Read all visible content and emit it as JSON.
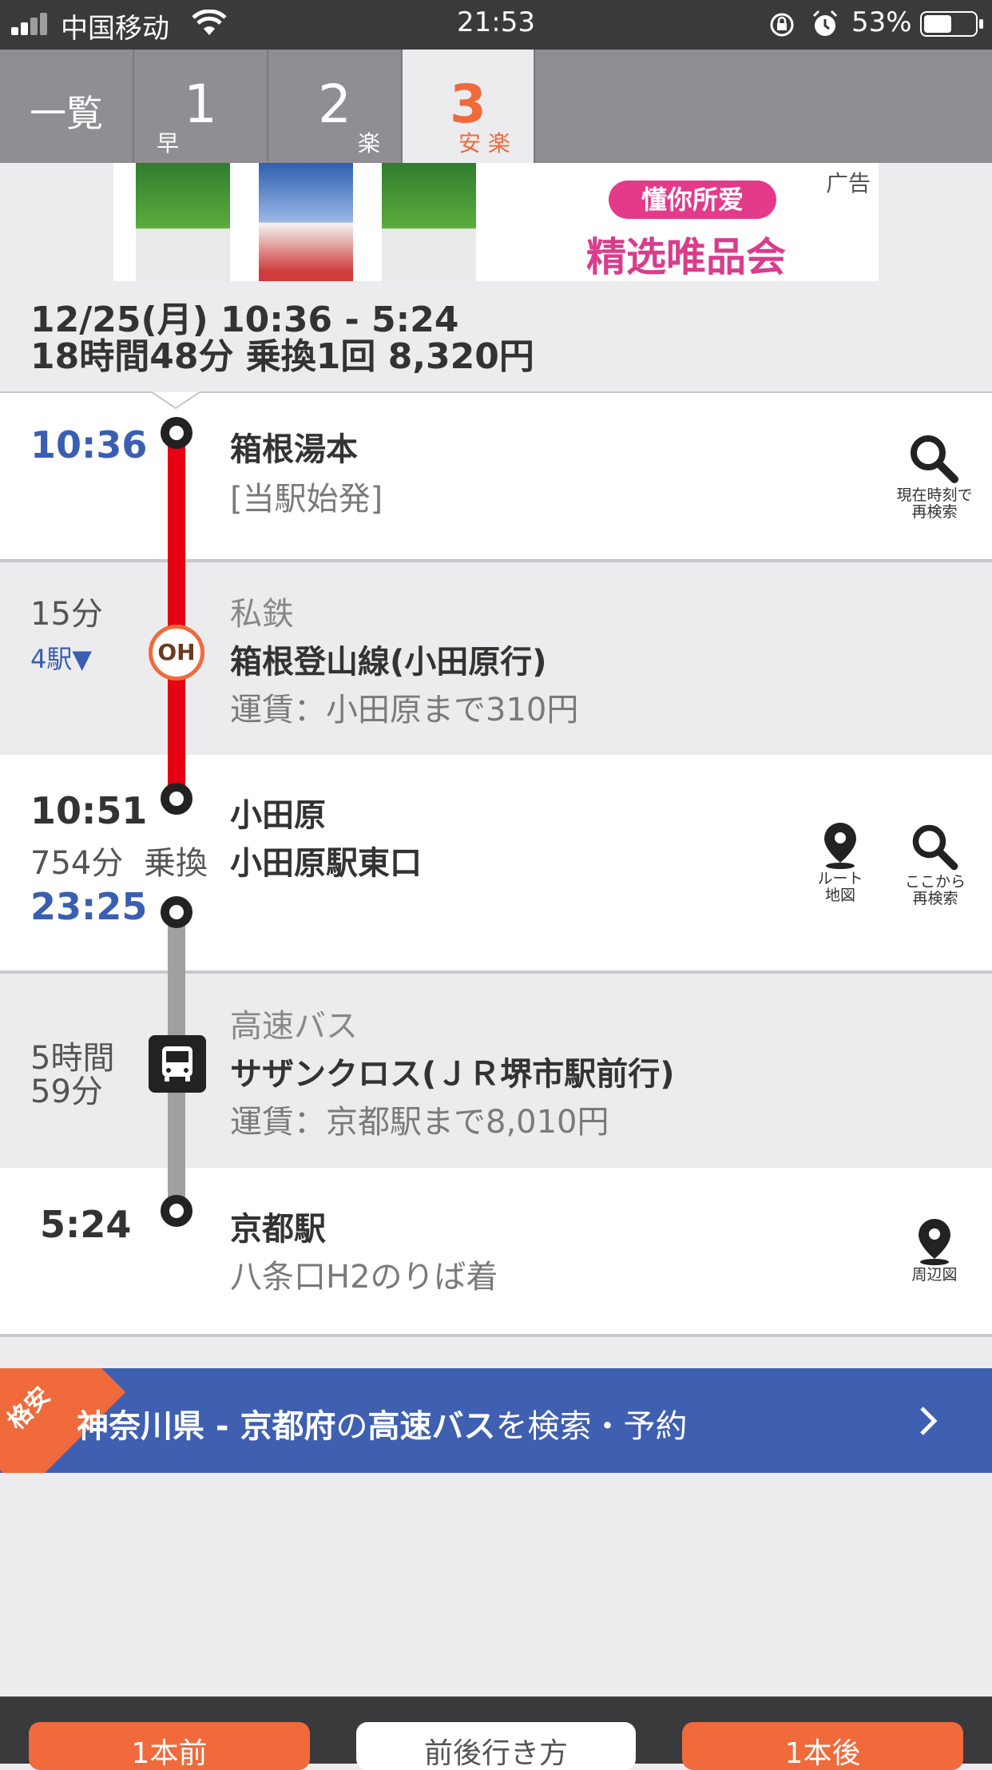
{
  "status_bar": {
    "carrier": "中国移动",
    "time": "21:53",
    "battery": "53%"
  },
  "tabs": [
    {
      "label": "一覧",
      "sub": ""
    },
    {
      "label": "1",
      "sub": "早"
    },
    {
      "label": "2",
      "sub": "楽"
    },
    {
      "label": "3",
      "sub": "安 楽"
    }
  ],
  "ad": {
    "headline": "懂你所爱",
    "sub": "精选唯品会",
    "tag": "广告"
  },
  "summary": {
    "line1": "12/25(月) 10:36 -  5:24",
    "line2": "18時間48分 乗換1回 8,320円"
  },
  "route": {
    "start": {
      "time": "10:36",
      "station": "箱根湯本",
      "note": "[当駅始発]",
      "action": "現在時刻で\n再検索"
    },
    "seg1": {
      "duration": "15分",
      "stops": "4駅▼",
      "type": "私鉄",
      "badge": "OH",
      "line": "箱根登山線(小田原行)",
      "fare": "運賃：小田原まで310円"
    },
    "transfer": {
      "arrive": "10:51",
      "wait": "754分",
      "transfer_label": "乗換",
      "depart": "23:25",
      "station": "小田原",
      "sub": "小田原駅東口",
      "map_label": "ルート\n地図",
      "search_label": "ここから\n再検索"
    },
    "seg2": {
      "duration": "5時間\n59分",
      "type": "高速バス",
      "line": "サザンクロス(ＪＲ堺市駅前行)",
      "fare": "運賃：京都駅まで8,010円"
    },
    "end": {
      "time": "5:24",
      "station": "京都駅",
      "note": "八条口H2のりば着",
      "map_label": "周辺図"
    }
  },
  "banner": {
    "corner": "格安",
    "text_a": "神奈川県 - 京都府",
    "text_b": "の",
    "text_c": "高速バス",
    "text_d": "を検索・予約"
  },
  "bottom_buttons": [
    "1本前",
    "前後行き方",
    "1本後"
  ],
  "colors": {
    "blue": "#3a5fb0",
    "orange": "#f06a3c",
    "line_red": "#e60012",
    "line_gray": "#a0a0a0"
  }
}
